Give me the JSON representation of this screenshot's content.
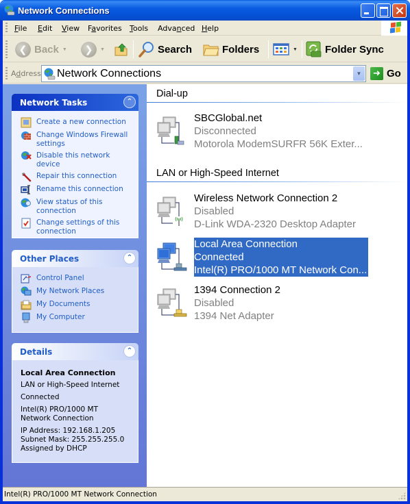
{
  "window": {
    "title": "Network Connections"
  },
  "menubar": {
    "items": [
      {
        "label": "File",
        "accel": "F",
        "rest": "ile"
      },
      {
        "label": "Edit",
        "accel": "E",
        "rest": "dit"
      },
      {
        "label": "View",
        "accel": "V",
        "rest": "iew"
      },
      {
        "label": "Favorites",
        "pre": "F",
        "accel": "a",
        "rest": "vorites"
      },
      {
        "label": "Tools",
        "accel": "T",
        "rest": "ools"
      },
      {
        "label": "Advanced",
        "pre": "Adva",
        "accel": "n",
        "rest": "ced"
      },
      {
        "label": "Help",
        "accel": "H",
        "rest": "elp"
      }
    ]
  },
  "toolbar": {
    "back_label": "Back",
    "search_label": "Search",
    "folders_label": "Folders",
    "folder_sync_label": "Folder Sync"
  },
  "address": {
    "label_pre": "A",
    "label_accel": "d",
    "label_rest": "dress",
    "value": "Network Connections",
    "go_label": "Go"
  },
  "taskpane": {
    "network_tasks": {
      "title": "Network Tasks",
      "links": [
        {
          "label": "Create a new connection",
          "icon": "new-connection-icon"
        },
        {
          "label": "Change Windows Firewall settings",
          "icon": "firewall-icon"
        },
        {
          "label": "Disable this network device",
          "icon": "disable-device-icon"
        },
        {
          "label": "Repair this connection",
          "icon": "repair-icon"
        },
        {
          "label": "Rename this connection",
          "icon": "rename-icon"
        },
        {
          "label": "View status of this connection",
          "icon": "view-status-icon"
        },
        {
          "label": "Change settings of this connection",
          "icon": "change-settings-icon"
        }
      ]
    },
    "other_places": {
      "title": "Other Places",
      "links": [
        {
          "label": "Control Panel",
          "icon": "control-panel-icon"
        },
        {
          "label": "My Network Places",
          "icon": "network-places-icon"
        },
        {
          "label": "My Documents",
          "icon": "my-documents-icon"
        },
        {
          "label": "My Computer",
          "icon": "my-computer-icon"
        }
      ]
    },
    "details": {
      "title": "Details",
      "name": "Local Area Connection",
      "type": "LAN or High-Speed Internet",
      "status": "Connected",
      "device": "Intel(R) PRO/1000 MT Network Connection",
      "ip": "IP Address: 192.168.1.205",
      "subnet": "Subnet Mask: 255.255.255.0",
      "assigned": "Assigned by DHCP"
    }
  },
  "groups": [
    {
      "title": "Dial-up",
      "connections": [
        {
          "name": "SBCGlobal.net",
          "status": "Disconnected",
          "device": "Motorola ModemSURFR 56K Exter...",
          "type": "modem",
          "selected": false
        }
      ]
    },
    {
      "title": "LAN or High-Speed Internet",
      "connections": [
        {
          "name": "Wireless Network Connection 2",
          "status": "Disabled",
          "device": "D-Link WDA-2320 Desktop Adapter",
          "type": "wireless",
          "selected": false
        },
        {
          "name": "Local Area Connection",
          "status": "Connected",
          "device": "Intel(R) PRO/1000 MT Network Con...",
          "type": "lan",
          "selected": true
        },
        {
          "name": "1394 Connection 2",
          "status": "Disabled",
          "device": "1394 Net Adapter",
          "type": "1394",
          "selected": false
        }
      ]
    }
  ],
  "statusbar": {
    "text": "Intel(R) PRO/1000 MT Network Connection"
  },
  "colors": {
    "selection": "#316ac5",
    "link": "#215dc6",
    "disabled_text": "#808080",
    "title_bar": "#0553d8"
  }
}
